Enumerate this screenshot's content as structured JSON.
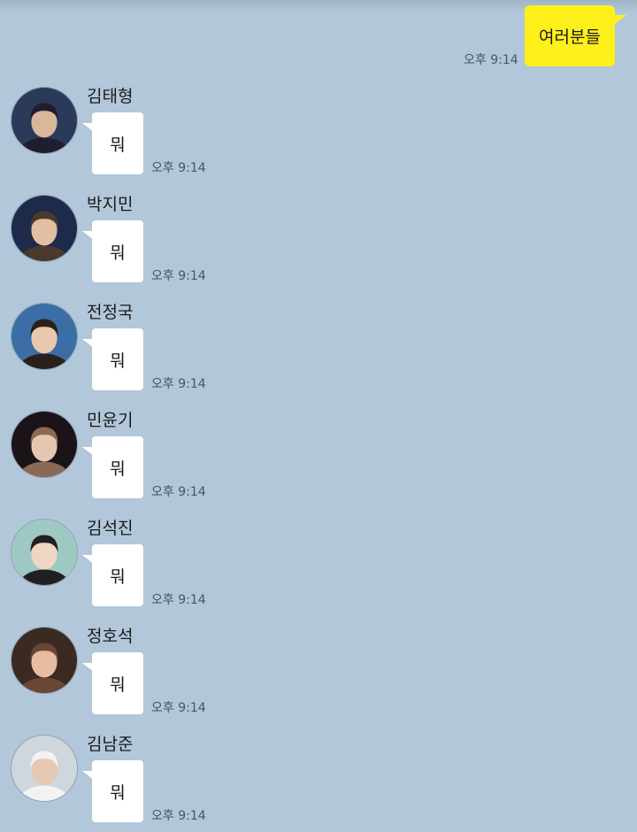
{
  "chat": {
    "outgoing": {
      "text": "여러분들",
      "time": "오후 9:14"
    },
    "incoming": [
      {
        "name": "김태형",
        "text": "뭐",
        "time": "오후 9:14",
        "avatar_colors": [
          "#2b3a58",
          "#d9b79a",
          "#1d1f2e"
        ]
      },
      {
        "name": "박지민",
        "text": "뭐",
        "time": "오후 9:14",
        "avatar_colors": [
          "#1e2a4a",
          "#e0bfa3",
          "#4a3a2c"
        ]
      },
      {
        "name": "전정국",
        "text": "뭐",
        "time": "오후 9:14",
        "avatar_colors": [
          "#3a6ea5",
          "#e8c8ae",
          "#2a1f1a"
        ]
      },
      {
        "name": "민윤기",
        "text": "뭐",
        "time": "오후 9:14",
        "avatar_colors": [
          "#1a1418",
          "#e5c6b1",
          "#8a6a55"
        ]
      },
      {
        "name": "김석진",
        "text": "뭐",
        "time": "오후 9:14",
        "avatar_colors": [
          "#9ec9c2",
          "#f0d5c2",
          "#202020"
        ]
      },
      {
        "name": "정호석",
        "text": "뭐",
        "time": "오후 9:14",
        "avatar_colors": [
          "#3a2a22",
          "#e7bda2",
          "#6b4634"
        ]
      },
      {
        "name": "김남준",
        "text": "뭐",
        "time": "오후 9:14",
        "avatar_colors": [
          "#cfd6dc",
          "#e6c7b1",
          "#f2f2f2"
        ]
      }
    ]
  },
  "colors": {
    "background": "#b2c7d9",
    "outgoing_bubble": "#fef01b",
    "incoming_bubble": "#ffffff"
  }
}
